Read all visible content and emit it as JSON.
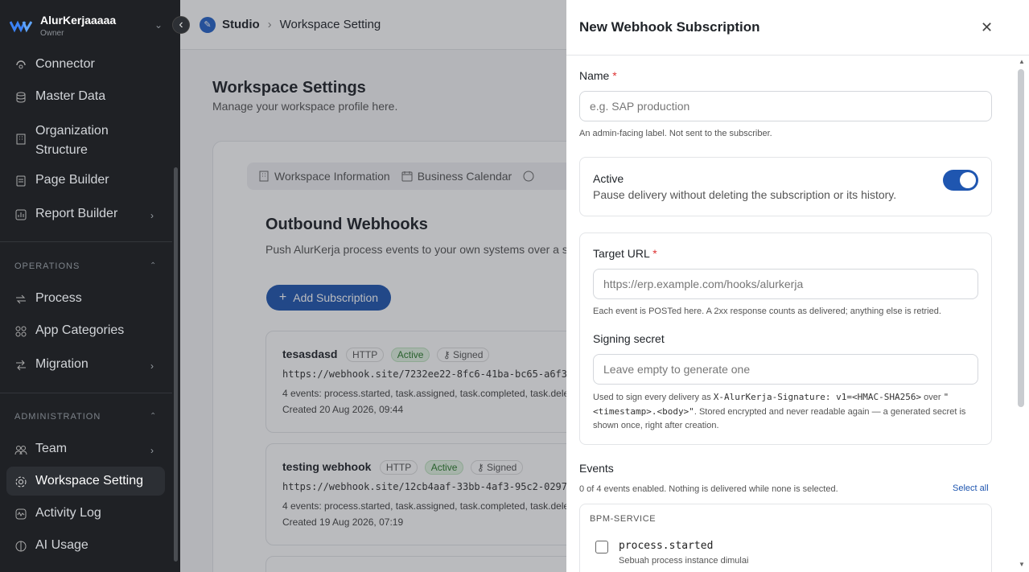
{
  "brand": {
    "name": "AlurKerjaaaaa",
    "role": "Owner"
  },
  "sidebar": {
    "items_top": [
      {
        "label": "Connector",
        "icon": "connector-icon"
      },
      {
        "label": "Master Data",
        "icon": "database-icon"
      },
      {
        "label": "Organization Structure",
        "icon": "org-icon"
      },
      {
        "label": "Page Builder",
        "icon": "page-icon"
      },
      {
        "label": "Report Builder",
        "icon": "report-icon"
      }
    ],
    "operations_label": "OPERATIONS",
    "operations": [
      {
        "label": "Process",
        "icon": "process-icon"
      },
      {
        "label": "App Categories",
        "icon": "categories-icon"
      },
      {
        "label": "Migration",
        "icon": "migration-icon"
      }
    ],
    "administration_label": "ADMINISTRATION",
    "administration": [
      {
        "label": "Team",
        "icon": "team-icon"
      },
      {
        "label": "Workspace Setting",
        "icon": "gear-icon"
      },
      {
        "label": "Activity Log",
        "icon": "activity-icon"
      },
      {
        "label": "AI Usage",
        "icon": "ai-icon"
      }
    ]
  },
  "breadcrumb": {
    "root": "Studio",
    "current": "Workspace Setting"
  },
  "page": {
    "title": "Workspace Settings",
    "subtitle": "Manage your workspace profile here."
  },
  "tabs": [
    "Workspace Information",
    "Business Calendar"
  ],
  "webhooks": {
    "title": "Outbound Webhooks",
    "description": "Push AlurKerja process events to your own systems over a si them.",
    "add_label": "Add Subscription",
    "subscriptions": [
      {
        "name": "tesasdasd",
        "protocol": "HTTP",
        "status": "Active",
        "signed": "Signed",
        "url": "https://webhook.site/7232ee22-8fc6-41ba-bc65-a6f3",
        "events": "4 events: process.started, task.assigned, task.completed, task.dele",
        "created": "Created 20 Aug 2026, 09:44"
      },
      {
        "name": "testing webhook",
        "protocol": "HTTP",
        "status": "Active",
        "signed": "Signed",
        "url": "https://webhook.site/12cb4aaf-33bb-4af3-95c2-0297",
        "events": "4 events: process.started, task.assigned, task.completed, task.dele",
        "created": "Created 19 Aug 2026, 07:19"
      }
    ]
  },
  "drawer": {
    "title": "New Webhook Subscription",
    "name_label": "Name",
    "name_placeholder": "e.g. SAP production",
    "name_help": "An admin-facing label. Not sent to the subscriber.",
    "active_label": "Active",
    "active_help": "Pause delivery without deleting the subscription or its history.",
    "active_on": true,
    "url_label": "Target URL",
    "url_placeholder": "https://erp.example.com/hooks/alurkerja",
    "url_help": "Each event is POSTed here. A 2xx response counts as delivered; anything else is retried.",
    "secret_label": "Signing secret",
    "secret_placeholder": "Leave empty to generate one",
    "secret_help_1": "Used to sign every delivery as",
    "secret_help_header": "X-AlurKerja-Signature: v1=<HMAC-SHA256>",
    "secret_help_2": "over",
    "secret_help_format": "\"<timestamp>.<body>\"",
    "secret_help_3": ". Stored encrypted and never readable again — a generated secret is shown once, right after creation.",
    "events_label": "Events",
    "events_status": "0 of 4 events enabled. Nothing is delivered while none is selected.",
    "select_all": "Select all",
    "service": "BPM-SERVICE",
    "event_name": "process.started",
    "event_desc": "Sebuah process instance dimulai"
  }
}
